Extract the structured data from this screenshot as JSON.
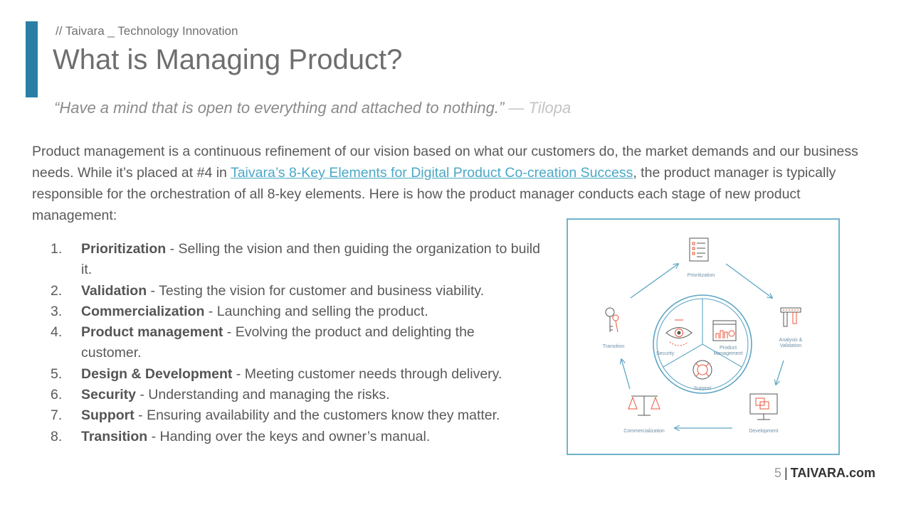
{
  "header": {
    "eyebrow": "// Taivara _ Technology Innovation",
    "title": "What is Managing Product?",
    "quote": "“Have a mind that is open to everything and attached to nothing.”",
    "quote_author": "— Tilopa"
  },
  "intro": {
    "before_link": "Product management is a continuous refinement of our vision based on what our customers do, the market demands and our business needs. While it’s placed at #4 in ",
    "link_text": "Taivara’s 8-Key Elements for Digital Product Co-creation Success",
    "after_link": ", the product manager is typically responsible for the orchestration of all 8-key elements. Here is how the product manager conducts each stage of new product management:"
  },
  "stages": [
    {
      "num": "1.",
      "title": "Prioritization",
      "desc": " - Selling the vision and then guiding the organization to build it."
    },
    {
      "num": "2.",
      "title": "Validation",
      "desc": " - Testing the vision for customer and business viability."
    },
    {
      "num": "3.",
      "title": "Commercialization",
      "desc": " - Launching and selling the product."
    },
    {
      "num": "4.",
      "title": "Product management",
      "desc": " - Evolving the product and delighting the customer."
    },
    {
      "num": "5.",
      "title": "Design & Development",
      "desc": " - Meeting customer needs through delivery."
    },
    {
      "num": "6.",
      "title": "Security",
      "desc": " - Understanding and managing the risks."
    },
    {
      "num": "7.",
      "title": "Support",
      "desc": " - Ensuring availability and the customers know they matter."
    },
    {
      "num": "8.",
      "title": "Transition",
      "desc": " - Handing over the keys and owner’s manual."
    }
  ],
  "diagram": {
    "outer_labels": {
      "prioritization": "Prioritization",
      "analysis_1": "Analysis &",
      "analysis_2": "Validation",
      "development": "Development",
      "commercialization": "Commercialization",
      "transition": "Transition"
    },
    "inner_labels": {
      "security": "Security",
      "product_1": "Product",
      "product_2": "Management",
      "support": "Support"
    },
    "colors": {
      "line": "#5ea6c4",
      "icon": "#555555",
      "accent": "#e8553a",
      "border": "#6fb3cc"
    }
  },
  "footer": {
    "page": "5",
    "separator": "|",
    "brand": "TAIVARA.com"
  },
  "colors": {
    "accent_bar": "#2a7fa6",
    "link": "#4aa8c6"
  }
}
